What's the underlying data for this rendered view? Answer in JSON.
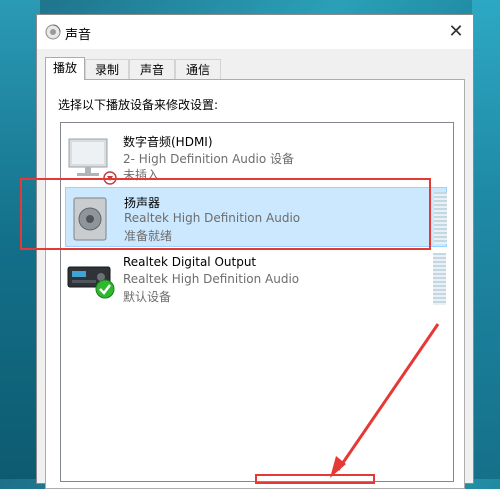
{
  "window": {
    "title": "声音",
    "close_glyph": "✕"
  },
  "tabs": [
    {
      "label": "播放",
      "active": true
    },
    {
      "label": "录制",
      "active": false
    },
    {
      "label": "声音",
      "active": false
    },
    {
      "label": "通信",
      "active": false
    }
  ],
  "panel": {
    "instruction": "选择以下播放设备来修改设置:"
  },
  "devices": [
    {
      "name": "数字音频(HDMI)",
      "line2": "2- High Definition Audio 设备",
      "line3": "未插入",
      "icon": "monitor-icon",
      "status_icon": "down-arrow-badge-icon",
      "selected": false
    },
    {
      "name": "扬声器",
      "line2": "Realtek High Definition Audio",
      "line3": "准备就绪",
      "icon": "speaker-icon",
      "selected": true
    },
    {
      "name": "Realtek Digital Output",
      "line2": "Realtek High Definition Audio",
      "line3": "默认设备",
      "icon": "receiver-icon",
      "status_icon": "check-badge-icon",
      "selected": false
    }
  ],
  "colors": {
    "selection": "#cce8ff",
    "annotation": "#e53935",
    "check": "#2eb82e"
  }
}
